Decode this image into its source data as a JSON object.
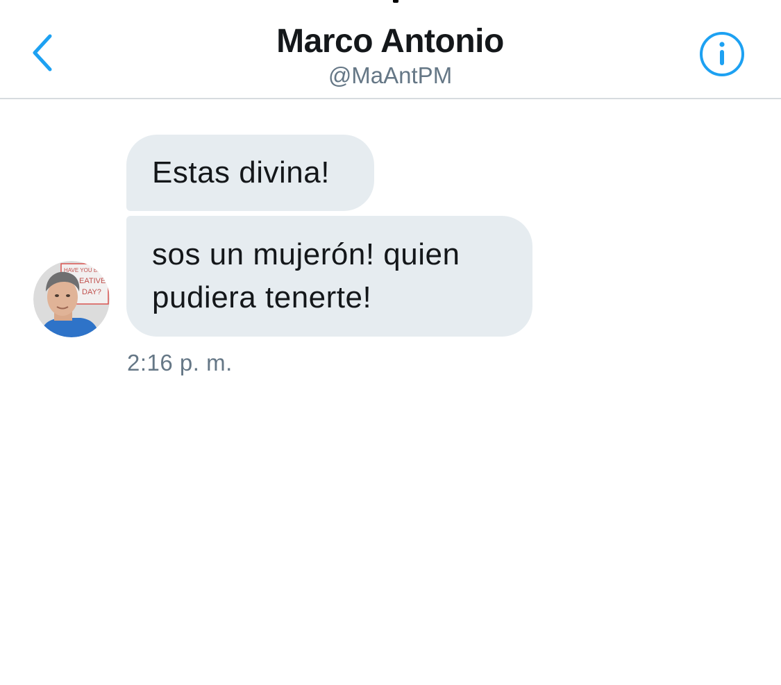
{
  "header": {
    "contact_name": "Marco Antonio",
    "contact_handle": "@MaAntPM",
    "back_icon": "chevron-left-icon",
    "info_icon": "info-circle-icon"
  },
  "messages": [
    {
      "text": "Estas divina!"
    },
    {
      "text": "sos un mujerón! quien pudiera tenerte!"
    }
  ],
  "message_group": {
    "timestamp": "2:16 p. m.",
    "avatar_icon": "profile-photo"
  },
  "avatar_poster": {
    "line1": "HAVE YOU BEEN",
    "line2": "EATIVE",
    "line3": "DAY?"
  },
  "colors": {
    "accent": "#1da1f2",
    "bubble_background": "#e6ecf0",
    "primary_text": "#14171a",
    "secondary_text": "#657786",
    "divider": "#d6dbdf"
  }
}
